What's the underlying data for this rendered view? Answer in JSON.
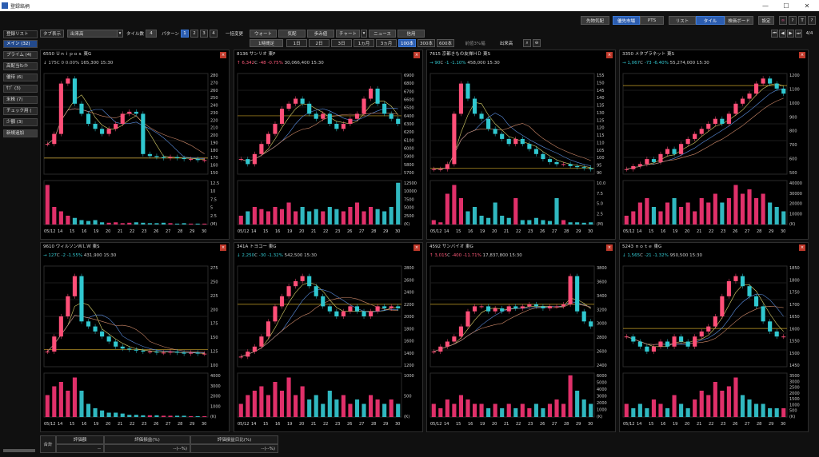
{
  "window": {
    "title": "登録銘柄",
    "minimize": "—",
    "maximize": "☐",
    "close": "✕"
  },
  "topbar": {
    "left": [
      "先物気配",
      "優先市場",
      "PTS"
    ],
    "right": [
      "リスト",
      "タイル",
      "株価ボード",
      "設定"
    ],
    "page": "4/4"
  },
  "sidebar": {
    "items": [
      "登録リスト",
      "メイン (32)",
      "プライム (4)",
      "高配当ｾﾚｸﾄ",
      "優待 (6)",
      "ｻﾌﾞ (3)",
      "米株 (7)",
      "チェック用 (",
      "少額 (3)"
    ],
    "add": "新規追加"
  },
  "controls": {
    "display_label": "タブ表示",
    "market": "出来高",
    "tile_label": "タイル数",
    "tile_count": "4",
    "pattern_label": "パターン",
    "patterns": [
      "1",
      "2",
      "3",
      "4"
    ],
    "bulk_label": "一括変更",
    "tabs": [
      "ウォート",
      "気配",
      "歩み値",
      "チャート",
      "ニュース",
      "信用"
    ],
    "interval": "1時間足",
    "ranges": [
      "1日",
      "2日",
      "3日",
      "1ヵ月",
      "3ヵ月"
    ],
    "bars": [
      "100本",
      "300本",
      "600本"
    ],
    "checks": [
      "前値3%幅",
      "出来高"
    ]
  },
  "panels": [
    {
      "code": "6550",
      "name": "Ｕｎｉｐｏｓ",
      "market": "東G",
      "arrow": "↓",
      "price": "175",
      "mark": "C",
      "change": "0",
      "pct": "0.00%",
      "volume": "165,300",
      "time": "15:30",
      "trend": "fl",
      "yticks": [
        "280",
        "270",
        "260",
        "250",
        "240",
        "230",
        "220",
        "210",
        "200",
        "190",
        "180",
        "170",
        "160",
        "150"
      ],
      "vticks": [
        "12.5",
        "10",
        "7.5",
        "5",
        "2.5",
        "(M)"
      ],
      "xticks": [
        "05/12",
        "14",
        "15",
        "16",
        "19",
        "20",
        "21",
        "22",
        "23",
        "26",
        "27",
        "28",
        "29",
        "30"
      ],
      "chart_data": {
        "type": "candlestick",
        "ylim": [
          150,
          285
        ],
        "shape": [
          0.3,
          0.4,
          0.9,
          0.95,
          0.7,
          0.6,
          0.5,
          0.45,
          0.4,
          0.45,
          0.5,
          0.6,
          0.62,
          0.6,
          0.2,
          0.18,
          0.17,
          0.16,
          0.17,
          0.16,
          0.15,
          0.15,
          0.14,
          0.14
        ],
        "volume": [
          0.9,
          0.4,
          0.3,
          0.2,
          0.15,
          0.1,
          0.08,
          0.1,
          0.05,
          0.04,
          0.05,
          0.03,
          0.04,
          0.05,
          0.04,
          0.03,
          0.03,
          0.04,
          0.03,
          0.02,
          0.03,
          0.02,
          0.02,
          0.02
        ],
        "hline": 0.16
      }
    },
    {
      "code": "8136",
      "name": "サンリオ",
      "market": "東P",
      "arrow": "↑",
      "price": "6,342",
      "mark": "C",
      "change": "-48",
      "pct": "-0.75%",
      "volume": "30,066,400",
      "time": "15:30",
      "trend": "up",
      "yticks": [
        "6900",
        "6800",
        "6700",
        "6600",
        "6500",
        "6400",
        "6300",
        "6200",
        "6100",
        "6000",
        "5900",
        "5800",
        "5700"
      ],
      "vticks": [
        "12500",
        "10000",
        "7500",
        "5000",
        "2500",
        "(K)"
      ],
      "xticks": [
        "05/12",
        "14",
        "15",
        "16",
        "19",
        "20",
        "21",
        "22",
        "23",
        "26",
        "27",
        "28",
        "29",
        "30"
      ],
      "chart_data": {
        "type": "candlestick",
        "ylim": [
          5650,
          6950
        ],
        "shape": [
          0.15,
          0.1,
          0.2,
          0.3,
          0.4,
          0.5,
          0.65,
          0.7,
          0.75,
          0.7,
          0.6,
          0.55,
          0.6,
          0.5,
          0.45,
          0.5,
          0.55,
          0.6,
          0.75,
          0.85,
          0.7,
          0.6,
          0.55,
          0.5
        ],
        "volume": [
          0.2,
          0.3,
          0.4,
          0.35,
          0.3,
          0.4,
          0.35,
          0.5,
          0.3,
          0.4,
          0.3,
          0.35,
          0.3,
          0.4,
          0.35,
          0.3,
          0.4,
          0.5,
          0.3,
          0.4,
          0.35,
          0.3,
          0.4,
          0.95
        ],
        "hline": 0.58
      }
    },
    {
      "code": "7615",
      "name": "京都きもの友禅ＨＤ",
      "market": "東S",
      "arrow": "→",
      "price": "90",
      "mark": "C",
      "change": "-1",
      "pct": "-1.10%",
      "volume": "458,000",
      "time": "15:30",
      "trend": "dn",
      "yticks": [
        "155",
        "150",
        "145",
        "140",
        "135",
        "130",
        "125",
        "120",
        "115",
        "110",
        "105",
        "100",
        "95",
        "90"
      ],
      "vticks": [
        "10.0",
        "7.5",
        "5.0",
        "2.5",
        "(M)"
      ],
      "xticks": [
        "05/12",
        "14",
        "15",
        "16",
        "19",
        "20",
        "21",
        "22",
        "23",
        "26",
        "27",
        "28",
        "29",
        "30"
      ],
      "chart_data": {
        "type": "candlestick",
        "ylim": [
          88,
          158
        ],
        "shape": [
          0.05,
          0.05,
          0.1,
          0.6,
          0.9,
          0.75,
          0.6,
          0.55,
          0.45,
          0.4,
          0.35,
          0.3,
          0.35,
          0.3,
          0.25,
          0.2,
          0.15,
          0.12,
          0.1,
          0.1,
          0.08,
          0.07,
          0.06,
          0.05
        ],
        "volume": [
          0.1,
          0.05,
          0.7,
          0.9,
          0.6,
          0.3,
          0.4,
          0.2,
          0.15,
          0.5,
          0.2,
          0.15,
          0.6,
          0.1,
          0.1,
          0.15,
          0.1,
          0.08,
          0.6,
          0.1,
          0.05,
          0.05,
          0.04,
          0.05
        ],
        "hline": 0.06
      }
    },
    {
      "code": "3350",
      "name": "メタプラネット",
      "market": "東S",
      "arrow": "→",
      "price": "1,067",
      "mark": "C",
      "change": "-73",
      "pct": "-6.40%",
      "volume": "55,274,000",
      "time": "15:30",
      "trend": "dn",
      "yticks": [
        "1200",
        "1100",
        "1000",
        "900",
        "800",
        "700",
        "600",
        "500"
      ],
      "vticks": [
        "40000",
        "30000",
        "20000",
        "10000",
        "(K)"
      ],
      "xticks": [
        "05/12",
        "14",
        "15",
        "16",
        "19",
        "20",
        "21",
        "22",
        "23",
        "26",
        "27",
        "28",
        "29",
        "30"
      ],
      "chart_data": {
        "type": "candlestick",
        "ylim": [
          450,
          1250
        ],
        "shape": [
          0.05,
          0.08,
          0.1,
          0.15,
          0.12,
          0.2,
          0.25,
          0.2,
          0.3,
          0.35,
          0.4,
          0.45,
          0.5,
          0.55,
          0.5,
          0.6,
          0.7,
          0.75,
          0.8,
          0.9,
          0.95,
          0.9,
          0.85,
          0.8
        ],
        "volume": [
          0.2,
          0.3,
          0.5,
          0.6,
          0.4,
          0.3,
          0.5,
          0.6,
          0.4,
          0.5,
          0.3,
          0.6,
          0.5,
          0.7,
          0.5,
          0.6,
          0.9,
          0.7,
          0.8,
          0.6,
          0.7,
          0.5,
          0.4,
          0.3
        ],
        "hline": 0.88
      }
    },
    {
      "code": "9610",
      "name": "ウィルソンＷＬＷ",
      "market": "東S",
      "arrow": "→",
      "price": "127",
      "mark": "C",
      "change": "-2",
      "pct": "-1.55%",
      "volume": "431,900",
      "time": "15:30",
      "trend": "dn",
      "yticks": [
        "275",
        "250",
        "225",
        "200",
        "175",
        "150",
        "125",
        "100"
      ],
      "vticks": [
        "4000",
        "3000",
        "2000",
        "1000",
        "(K)"
      ],
      "xticks": [
        "05/12",
        "14",
        "15",
        "16",
        "19",
        "20",
        "21",
        "22",
        "23",
        "26",
        "27",
        "28",
        "29",
        "30"
      ],
      "chart_data": {
        "type": "candlestick",
        "ylim": [
          90,
          290
        ],
        "shape": [
          0.15,
          0.3,
          0.5,
          0.7,
          0.9,
          0.45,
          0.4,
          0.35,
          0.3,
          0.25,
          0.2,
          0.18,
          0.17,
          0.16,
          0.15,
          0.15,
          0.14,
          0.14,
          0.15,
          0.14,
          0.13,
          0.14,
          0.13,
          0.13
        ],
        "volume": [
          0.5,
          0.7,
          0.8,
          0.6,
          0.9,
          0.6,
          0.3,
          0.2,
          0.15,
          0.1,
          0.1,
          0.08,
          0.05,
          0.05,
          0.04,
          0.04,
          0.04,
          0.03,
          0.03,
          0.03,
          0.03,
          0.02,
          0.02,
          0.02
        ],
        "hline": 0.17
      }
    },
    {
      "code": "341A",
      "name": "トヨコー",
      "market": "東G",
      "arrow": "↓",
      "price": "2,250",
      "mark": "C",
      "change": "-30",
      "pct": "-1.32%",
      "volume": "542,500",
      "time": "15:30",
      "trend": "dn",
      "yticks": [
        "2800",
        "2600",
        "2400",
        "2200",
        "2000",
        "1800",
        "1600",
        "1400",
        "1200"
      ],
      "vticks": [
        "1000",
        "500",
        "(K)"
      ],
      "xticks": [
        "05/12",
        "14",
        "15",
        "16",
        "19",
        "20",
        "21",
        "22",
        "23",
        "26",
        "27",
        "28",
        "29",
        "30"
      ],
      "chart_data": {
        "type": "candlestick",
        "ylim": [
          1150,
          2850
        ],
        "shape": [
          0.1,
          0.15,
          0.2,
          0.3,
          0.45,
          0.6,
          0.7,
          0.8,
          0.85,
          0.9,
          0.8,
          0.7,
          0.6,
          0.55,
          0.5,
          0.55,
          0.6,
          0.55,
          0.5,
          0.55,
          0.6,
          0.58,
          0.6,
          0.58
        ],
        "volume": [
          0.3,
          0.5,
          0.6,
          0.7,
          0.5,
          0.8,
          0.6,
          0.9,
          0.5,
          0.7,
          0.4,
          0.5,
          0.3,
          0.6,
          0.4,
          0.5,
          0.3,
          0.4,
          0.3,
          0.5,
          0.4,
          0.3,
          0.4,
          0.3
        ],
        "hline": 0.62
      }
    },
    {
      "code": "4592",
      "name": "サンバイオ",
      "market": "東G",
      "arrow": "↑",
      "price": "3,015",
      "mark": "C",
      "change": "-400",
      "pct": "-11.71%",
      "volume": "17,837,800",
      "time": "15:30",
      "trend": "up",
      "yticks": [
        "3800",
        "3600",
        "3400",
        "3200",
        "3000",
        "2800",
        "2600",
        "2400"
      ],
      "vticks": [
        "6000",
        "5000",
        "4000",
        "3000",
        "2000",
        "1000",
        "(K)"
      ],
      "xticks": [
        "05/12",
        "14",
        "15",
        "16",
        "19",
        "20",
        "21",
        "22",
        "23",
        "26",
        "27",
        "28",
        "29",
        "30"
      ],
      "chart_data": {
        "type": "candlestick",
        "ylim": [
          2250,
          3950
        ],
        "shape": [
          0.15,
          0.2,
          0.25,
          0.3,
          0.4,
          0.55,
          0.6,
          0.6,
          0.55,
          0.58,
          0.55,
          0.6,
          0.58,
          0.6,
          0.62,
          0.6,
          0.58,
          0.6,
          0.6,
          0.62,
          0.9,
          0.55,
          0.45,
          0.4
        ],
        "volume": [
          0.3,
          0.2,
          0.4,
          0.3,
          0.5,
          0.4,
          0.3,
          0.3,
          0.2,
          0.3,
          0.2,
          0.3,
          0.2,
          0.3,
          0.2,
          0.3,
          0.2,
          0.3,
          0.4,
          0.3,
          0.95,
          0.6,
          0.4,
          0.3
        ],
        "hline": 0.62
      }
    },
    {
      "code": "5243",
      "name": "ｎｏｔｅ",
      "market": "東G",
      "arrow": "↓",
      "price": "1,565",
      "mark": "C",
      "change": "-21",
      "pct": "-1.32%",
      "volume": "950,500",
      "time": "15:30",
      "trend": "dn",
      "yticks": [
        "1850",
        "1800",
        "1750",
        "1700",
        "1650",
        "1600",
        "1550",
        "1500",
        "1450"
      ],
      "vticks": [
        "3500",
        "3000",
        "2500",
        "2000",
        "1500",
        "1000",
        "500",
        "(K)"
      ],
      "xticks": [
        "05/12",
        "14",
        "15",
        "16",
        "19",
        "20",
        "21",
        "22",
        "23",
        "26",
        "27",
        "28",
        "29",
        "30"
      ],
      "chart_data": {
        "type": "candlestick",
        "ylim": [
          1430,
          1870
        ],
        "shape": [
          0.3,
          0.25,
          0.2,
          0.15,
          0.2,
          0.25,
          0.2,
          0.3,
          0.25,
          0.2,
          0.3,
          0.35,
          0.4,
          0.5,
          0.7,
          0.85,
          0.9,
          0.8,
          0.7,
          0.6,
          0.45,
          0.35,
          0.3,
          0.3
        ],
        "volume": [
          0.3,
          0.2,
          0.3,
          0.2,
          0.4,
          0.3,
          0.2,
          0.5,
          0.3,
          0.2,
          0.4,
          0.6,
          0.5,
          0.8,
          0.6,
          0.7,
          0.9,
          0.5,
          0.4,
          0.3,
          0.3,
          0.2,
          0.2,
          0.2
        ],
        "hline": 0.38
      }
    }
  ],
  "footer": {
    "headers": [
      "評価額",
      "評価損益(%)",
      "評価損益日比(%)"
    ],
    "row_label": "合計",
    "values": [
      "--",
      "--(--%)",
      "--(--%)"
    ]
  }
}
